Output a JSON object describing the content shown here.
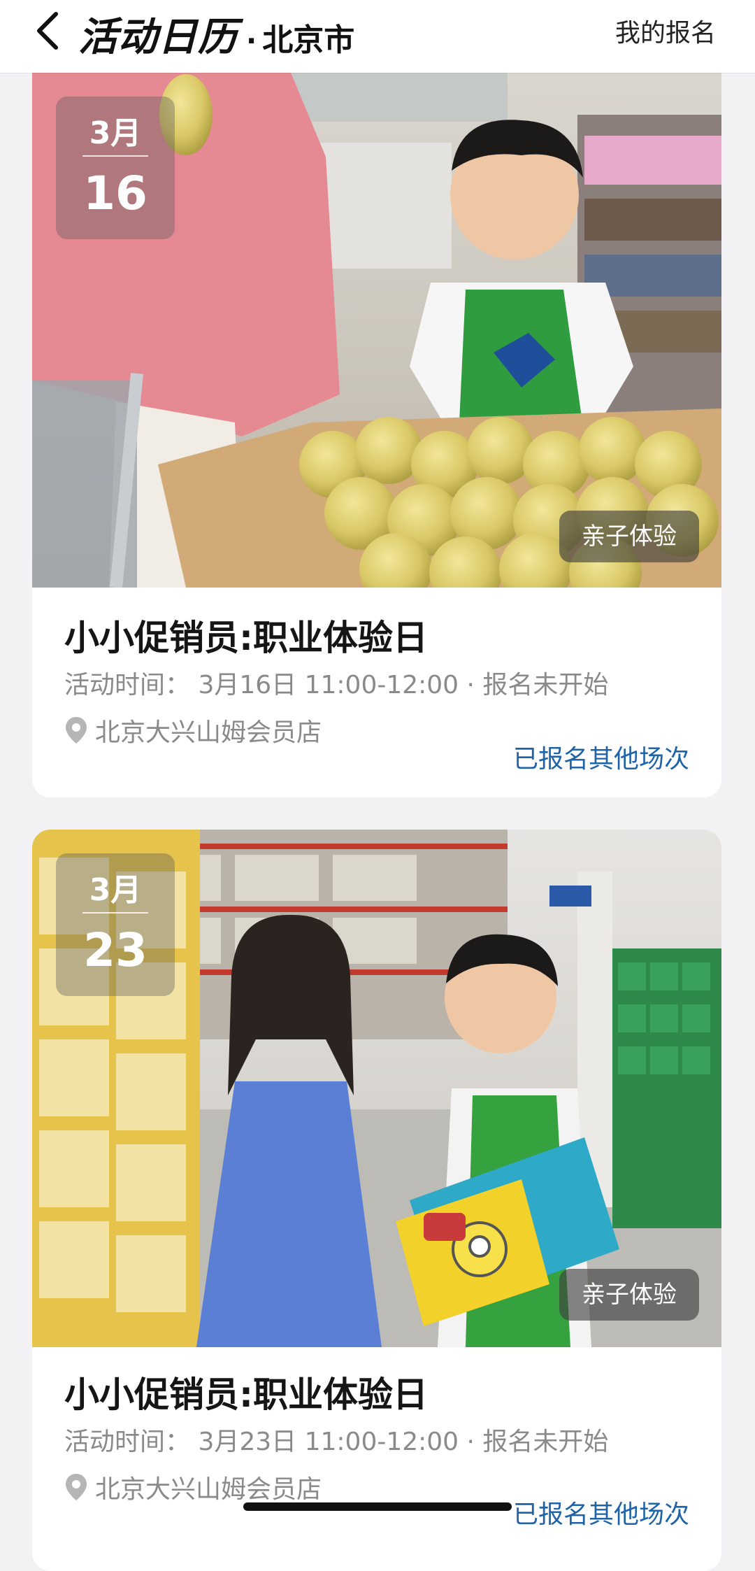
{
  "header": {
    "title": "活动日历",
    "separator": "·",
    "city": "北京市",
    "my_signup": "我的报名"
  },
  "events": [
    {
      "month": "3月",
      "day": "16",
      "tag": "亲子体验",
      "title": "小小促销员:职业体验日",
      "time": "活动时间： 3月16日 11:00-12:00 · 报名未开始",
      "location": "北京大兴山姆会员店",
      "action": "已报名其他场次"
    },
    {
      "month": "3月",
      "day": "23",
      "tag": "亲子体验",
      "title": "小小促销员:职业体验日",
      "time": "活动时间： 3月23日 11:00-12:00 · 报名未开始",
      "location": "北京大兴山姆会员店",
      "action": "已报名其他场次"
    }
  ],
  "colors": {
    "accent_link": "#1f63a8",
    "page_bg": "#f2f2f4"
  },
  "icons": [
    "back-chevron-icon",
    "location-pin-icon"
  ]
}
